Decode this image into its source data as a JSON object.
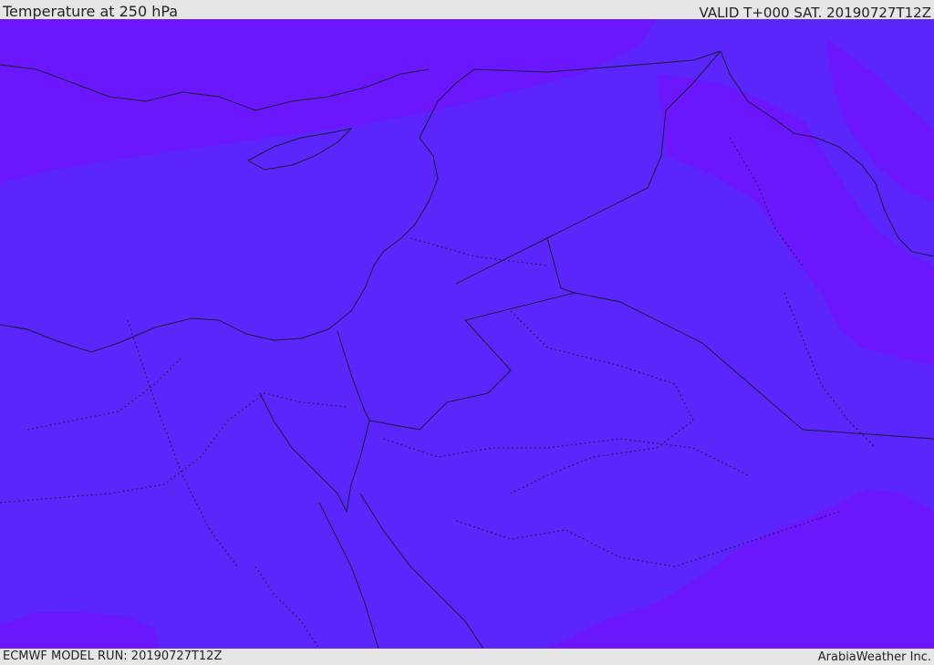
{
  "header": {
    "title": "Temperature at 250 hPa",
    "valid": "VALID T+000 SAT. 20190727T12Z"
  },
  "footer": {
    "model_run": "ECMWF MODEL RUN: 20190727T12Z",
    "brand": "ArabiaWeather Inc."
  },
  "map": {
    "field": "Temperature at 250 hPa",
    "colors": {
      "cold_band": "#6c16fd",
      "main_band": "#5a26fc",
      "border_line": "#1a1a3a"
    }
  }
}
